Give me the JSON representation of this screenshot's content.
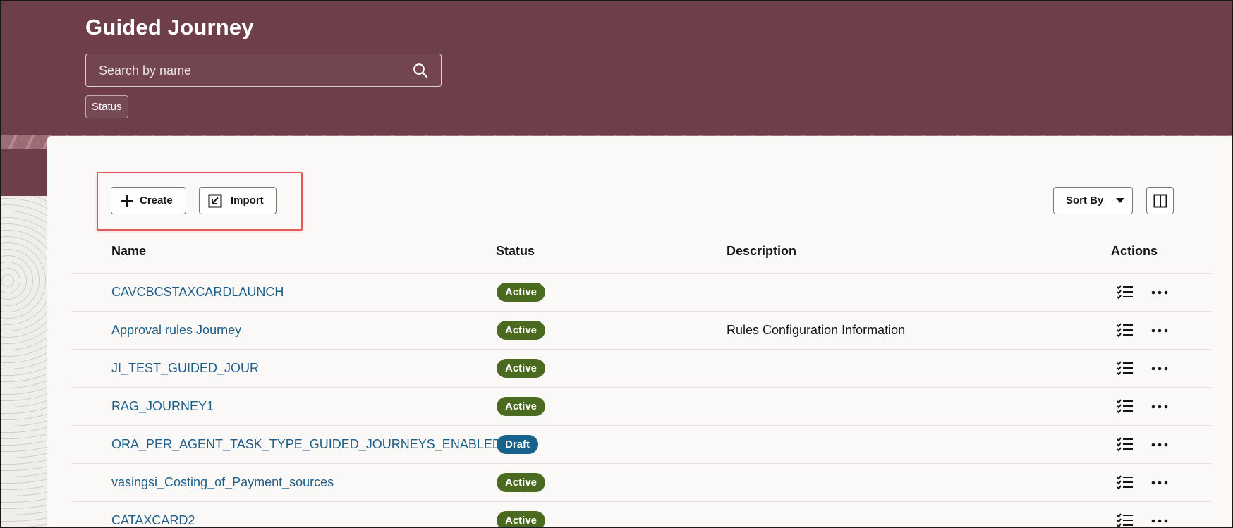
{
  "header": {
    "title": "Guided Journey",
    "search_placeholder": "Search by name",
    "search_icon": "search-icon",
    "filter_chip": "Status"
  },
  "toolbar": {
    "create_label": "Create",
    "create_icon": "plus-icon",
    "import_label": "Import",
    "import_icon": "import-icon",
    "sort_label": "Sort By",
    "sort_icon": "caret-down-icon",
    "layout_icon": "split-view-icon"
  },
  "table": {
    "columns": [
      "Name",
      "Status",
      "Description",
      "Actions"
    ],
    "rows": [
      {
        "name": "CAVCBCSTAXCARDLAUNCH",
        "status": "Active",
        "description": ""
      },
      {
        "name": "Approval rules Journey",
        "status": "Active",
        "description": "Rules Configuration Information"
      },
      {
        "name": "JI_TEST_GUIDED_JOUR",
        "status": "Active",
        "description": ""
      },
      {
        "name": "RAG_JOURNEY1",
        "status": "Active",
        "description": ""
      },
      {
        "name": "ORA_PER_AGENT_TASK_TYPE_GUIDED_JOURNEYS_ENABLED",
        "status": "Draft",
        "description": ""
      },
      {
        "name": "vasingsi_Costing_of_Payment_sources",
        "status": "Active",
        "description": ""
      },
      {
        "name": "CATAXCARD2",
        "status": "Active",
        "description": ""
      }
    ],
    "row_action_icons": [
      "checklist-icon",
      "more-options-icon"
    ]
  },
  "colors": {
    "header_bg": "#6e3e4a",
    "active_badge": "#4a6b1f",
    "draft_badge": "#17618a",
    "link": "#1d5e8a",
    "highlight_box": "#e05a5a"
  }
}
